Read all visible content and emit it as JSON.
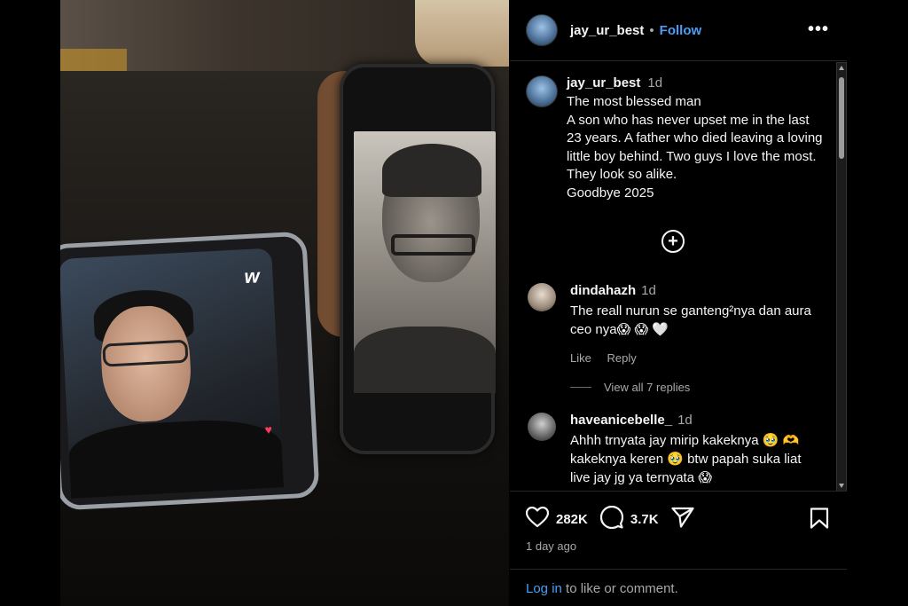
{
  "post": {
    "username": "jay_ur_best",
    "follow_label": "Follow",
    "dot": "•",
    "more_label": "•••",
    "caption": {
      "username": "jay_ur_best",
      "time": "1d",
      "text": "The most blessed man\nA son who has never upset me in the last 23 years. A father who died leaving a loving little boy behind. Two guys I love the most. They look so alike.\nGoodbye 2025"
    },
    "load_more_icon": "plus-circle-icon",
    "comments": [
      {
        "username": "dindahazh",
        "time": "1d",
        "text": "The reall nurun se ganteng²nya dan aura ceo nya😱 😱 🤍",
        "like_label": "Like",
        "reply_label": "Reply",
        "view_replies_label": "View all 7 replies"
      },
      {
        "username": "haveanicebelle_",
        "time": "1d",
        "text": "Ahhh trnyata jay mirip kakeknya 🥹 🫶 kakeknya keren 🥹 btw papah suka liat live jay jg ya ternyata 😱"
      }
    ],
    "likes_count": "282K",
    "comments_count": "3.7K",
    "time_ago": "1 day ago",
    "login_link": "Log in",
    "login_suffix": " to like or comment."
  },
  "photo": {
    "sticker_logo": "w"
  },
  "colors": {
    "background": "#000000",
    "accent": "#4a9ef5",
    "muted_text": "#a8a8a8"
  }
}
